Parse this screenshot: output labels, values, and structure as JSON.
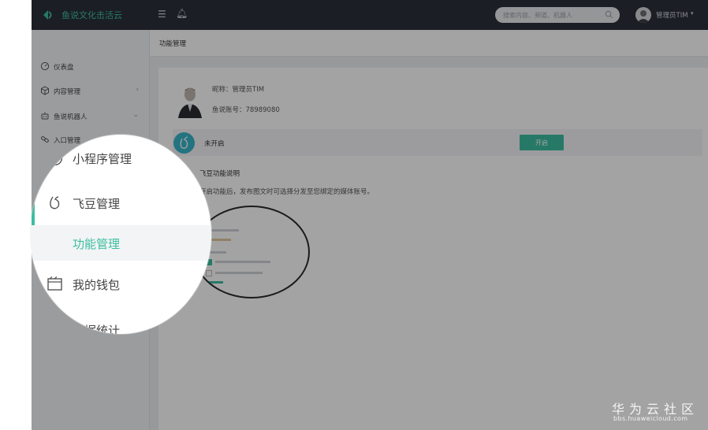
{
  "app": {
    "title": "鱼说文化击活云",
    "brand_color": "#3dbea2",
    "topbar_color": "#2b2f3a"
  },
  "topbar": {
    "menu_icon": "menu-icon",
    "bell_icon": "bell-icon",
    "search_placeholder": "搜索内容、频道、机器人",
    "user_name": "管理员TIM",
    "caret": "▾"
  },
  "sidebar": {
    "items": [
      {
        "label": "仪表盘",
        "icon": "dashboard-icon",
        "arrow": ""
      },
      {
        "label": "内容管理",
        "icon": "cube-icon",
        "arrow": "›"
      },
      {
        "label": "鱼说机器人",
        "icon": "robot-icon",
        "arrow": "⌄"
      },
      {
        "label": "入口管理",
        "icon": "link-icon",
        "arrow": ""
      }
    ]
  },
  "main": {
    "breadcrumb": "功能管理",
    "profile": {
      "nickname": "昵称：管理员TIM",
      "account": "鱼说账号：78989080"
    },
    "status": {
      "text": "未开启",
      "button_label": "开启"
    },
    "feature": {
      "title": "飞豆功能说明",
      "description": "开启功能后，发布图文时可选择分发至您绑定的媒体账号。"
    }
  },
  "magnifier": {
    "items": [
      {
        "label": "小程序管理",
        "icon": "mini-program-icon"
      },
      {
        "label": "飞豆管理",
        "icon": "feidou-icon"
      },
      {
        "label": "功能管理",
        "icon": ""
      },
      {
        "label": "我的钱包",
        "icon": "wallet-icon"
      },
      {
        "label": "数据统计",
        "icon": "chart-icon"
      }
    ]
  },
  "watermark": {
    "title": "华为云社区",
    "url": "bbs.huaweicloud.com"
  }
}
